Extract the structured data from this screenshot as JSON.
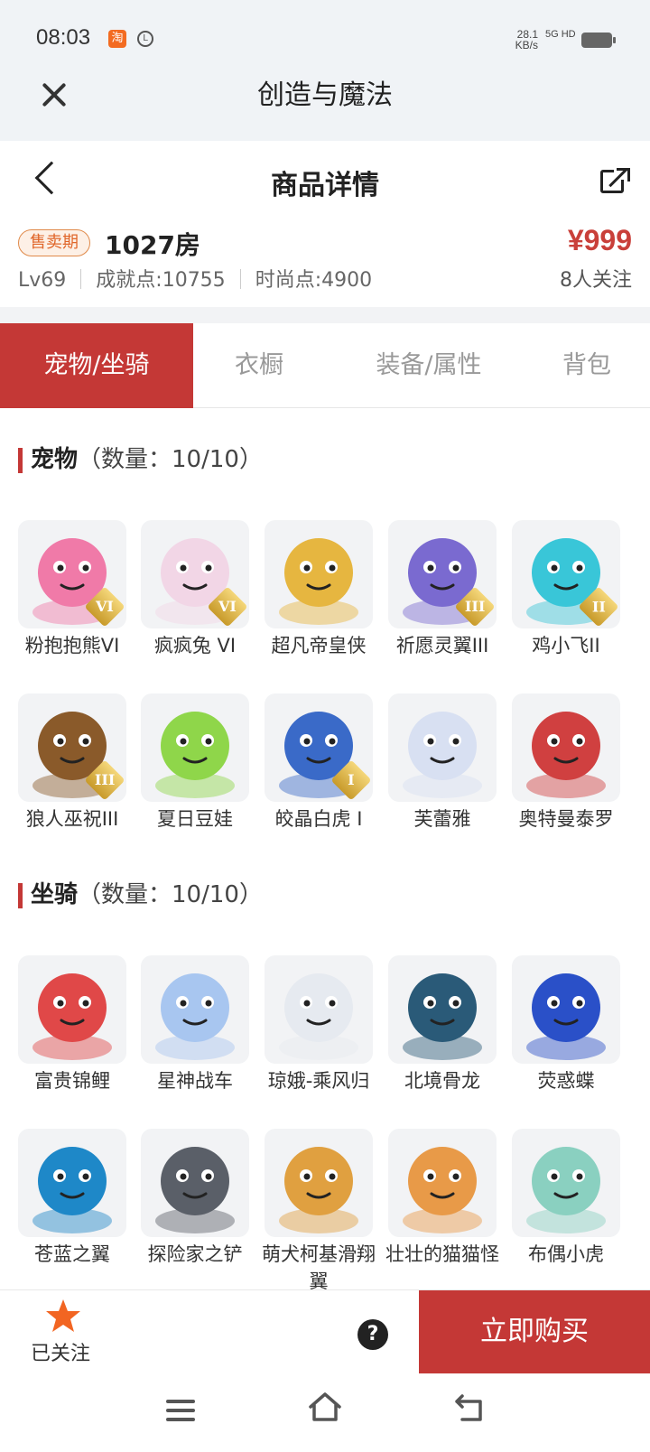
{
  "status_bar": {
    "time": "08:03",
    "speed_value": "28.1",
    "speed_unit": "KB/s",
    "network": "5G HD"
  },
  "app": {
    "title": "创造与魔法"
  },
  "nav": {
    "page_title": "商品详情"
  },
  "listing": {
    "status_tag": "售卖期",
    "name": "1027房",
    "price": "¥999",
    "level": "Lv69",
    "achievement": "成就点:10755",
    "fashion": "时尚点:4900",
    "followers": "8人关注"
  },
  "tabs": [
    {
      "label": "宠物/坐骑",
      "active": true
    },
    {
      "label": "衣橱",
      "active": false
    },
    {
      "label": "装备/属性",
      "active": false
    },
    {
      "label": "背包",
      "active": false
    }
  ],
  "sections": {
    "pets": {
      "title": "宠物",
      "count": "（数量：10/10）",
      "items": [
        {
          "name": "粉抱抱熊VI",
          "badge": "VI",
          "icon": "pink-bear-icon",
          "color": "#f07aa8"
        },
        {
          "name": "疯疯兔 VI",
          "badge": "VI",
          "icon": "rabbit-icon",
          "color": "#f2d6e6"
        },
        {
          "name": "超凡帝皇侠",
          "badge": "",
          "icon": "golden-hero-icon",
          "color": "#e6b640"
        },
        {
          "name": "祈愿灵翼III",
          "badge": "III",
          "icon": "eagle-icon",
          "color": "#7a6ad0"
        },
        {
          "name": "鸡小飞II",
          "badge": "II",
          "icon": "chick-icon",
          "color": "#39c6d8"
        },
        {
          "name": "狼人巫祝III",
          "badge": "III",
          "icon": "werewolf-icon",
          "color": "#8a5a2a"
        },
        {
          "name": "夏日豆娃",
          "badge": "",
          "icon": "bean-icon",
          "color": "#8fd64a"
        },
        {
          "name": "皎晶白虎 I",
          "badge": "I",
          "icon": "white-tiger-icon",
          "color": "#3a6ac8"
        },
        {
          "name": "芙蕾雅",
          "badge": "",
          "icon": "valkyrie-icon",
          "color": "#d8e0f2"
        },
        {
          "name": "奥特曼泰罗",
          "badge": "",
          "icon": "ultraman-icon",
          "color": "#d04040"
        }
      ]
    },
    "mounts": {
      "title": "坐骑",
      "count": "（数量：10/10）",
      "items": [
        {
          "name": "富贵锦鲤",
          "icon": "koi-icon",
          "color": "#e04848"
        },
        {
          "name": "星神战车",
          "icon": "star-horse-icon",
          "color": "#a8c6f0"
        },
        {
          "name": "琼娥-乘风归",
          "icon": "moon-lady-icon",
          "color": "#e6eaf0"
        },
        {
          "name": "北境骨龙",
          "icon": "bone-dragon-icon",
          "color": "#2a5a78"
        },
        {
          "name": "荧惑蝶",
          "icon": "butterfly-icon",
          "color": "#2a50c8"
        },
        {
          "name": "苍蓝之翼",
          "icon": "blue-wing-icon",
          "color": "#1e88c8"
        },
        {
          "name": "探险家之铲",
          "icon": "shovel-icon",
          "color": "#5a5f68"
        },
        {
          "name": "萌犬柯基滑翔翼",
          "icon": "corgi-icon",
          "color": "#e0a040"
        },
        {
          "name": "壮壮的猫猫怪",
          "icon": "cat-icon",
          "color": "#e89a48"
        },
        {
          "name": "布偶小虎",
          "icon": "tiger-doll-icon",
          "color": "#8ad0c0"
        }
      ]
    }
  },
  "bottom_bar": {
    "follow_label": "已关注",
    "help": "?",
    "buy_label": "立即购买"
  },
  "colors": {
    "accent": "#c43836",
    "price": "#c9403a",
    "tag": "#e0662a",
    "star": "#f26522"
  }
}
